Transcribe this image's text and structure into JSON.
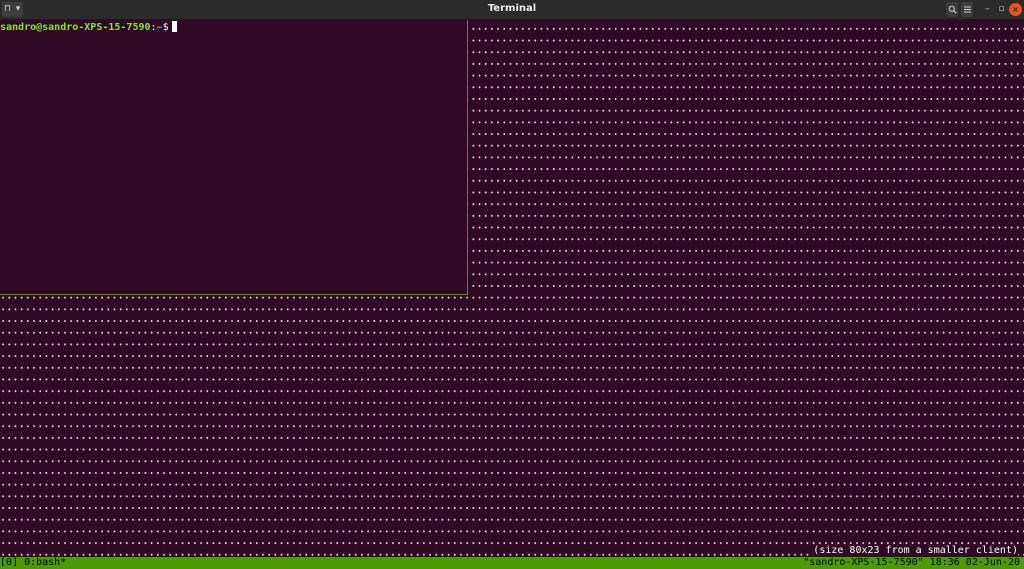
{
  "window": {
    "title": "Terminal",
    "new_tab_icon": "new-tab-icon",
    "dropdown_icon": "chevron-down-icon",
    "search_icon": "search-icon",
    "menu_icon": "hamburger-menu-icon",
    "minimize_label": "–",
    "maximize_label": "▫",
    "close_label": "×"
  },
  "terminal": {
    "prompt_user_host": "sandro@sandro-XPS-15-7590",
    "prompt_separator": ":",
    "prompt_path": "~",
    "prompt_symbol": "$",
    "size_message": "(size 80x23 from a smaller client)"
  },
  "statusbar": {
    "left": "[0] 0:bash*",
    "right": "\"sandro-XPS-15-7590\" 18:36 02-Jun-20"
  },
  "colors": {
    "background": "#300a24",
    "status_bar": "#4e9a06",
    "prompt_user": "#8ae234",
    "prompt_path": "#729fcf",
    "close_button": "#e95420"
  }
}
